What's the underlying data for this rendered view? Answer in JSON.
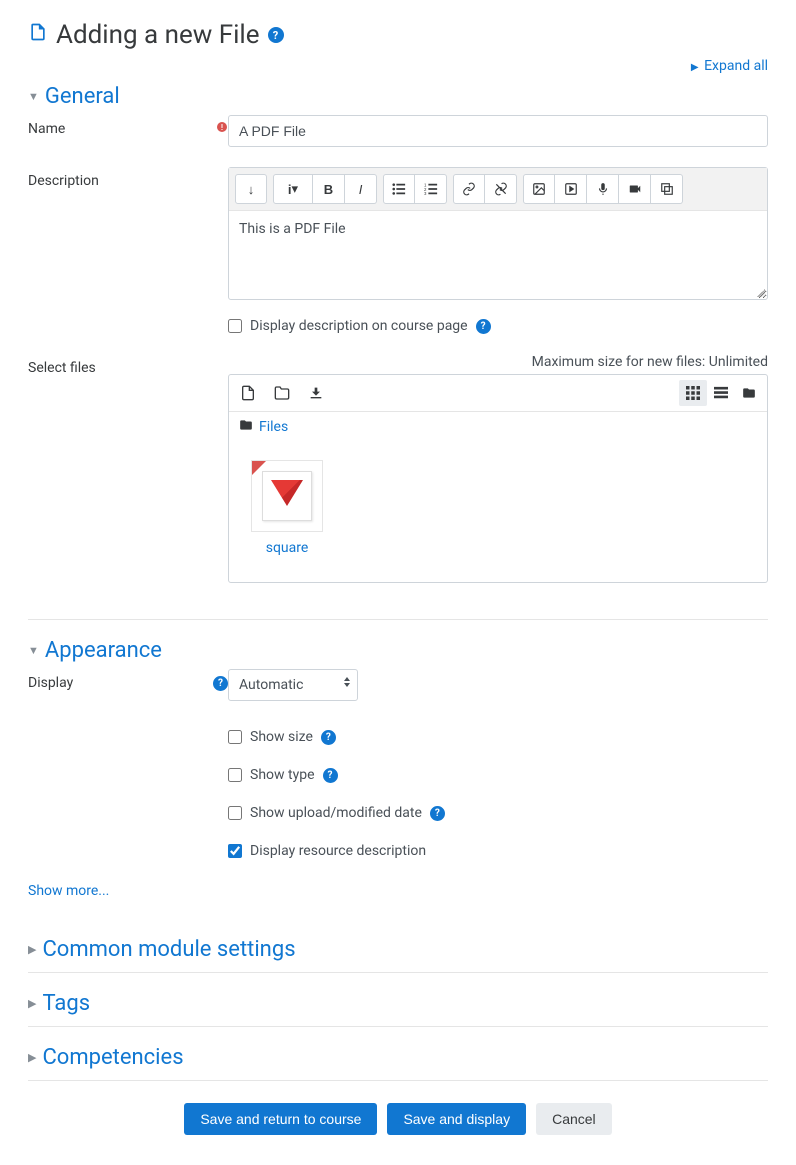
{
  "page": {
    "title": "Adding a new File"
  },
  "expand_all": "Expand all",
  "sections": {
    "general": {
      "title": "General",
      "name_label": "Name",
      "name_value": "A PDF File",
      "description_label": "Description",
      "description_value": "This is a PDF File",
      "display_desc_label": "Display description on course page",
      "select_files_label": "Select files",
      "max_size_label": "Maximum size for new files: Unlimited",
      "breadcrumb_files": "Files",
      "file_item_name": "square"
    },
    "appearance": {
      "title": "Appearance",
      "display_label": "Display",
      "display_value": "Automatic",
      "show_size": "Show size",
      "show_type": "Show type",
      "show_date": "Show upload/modified date",
      "display_res_desc": "Display resource description",
      "show_more": "Show more..."
    },
    "common": {
      "title": "Common module settings"
    },
    "tags": {
      "title": "Tags"
    },
    "competencies": {
      "title": "Competencies"
    }
  },
  "buttons": {
    "save_return": "Save and return to course",
    "save_display": "Save and display",
    "cancel": "Cancel"
  }
}
